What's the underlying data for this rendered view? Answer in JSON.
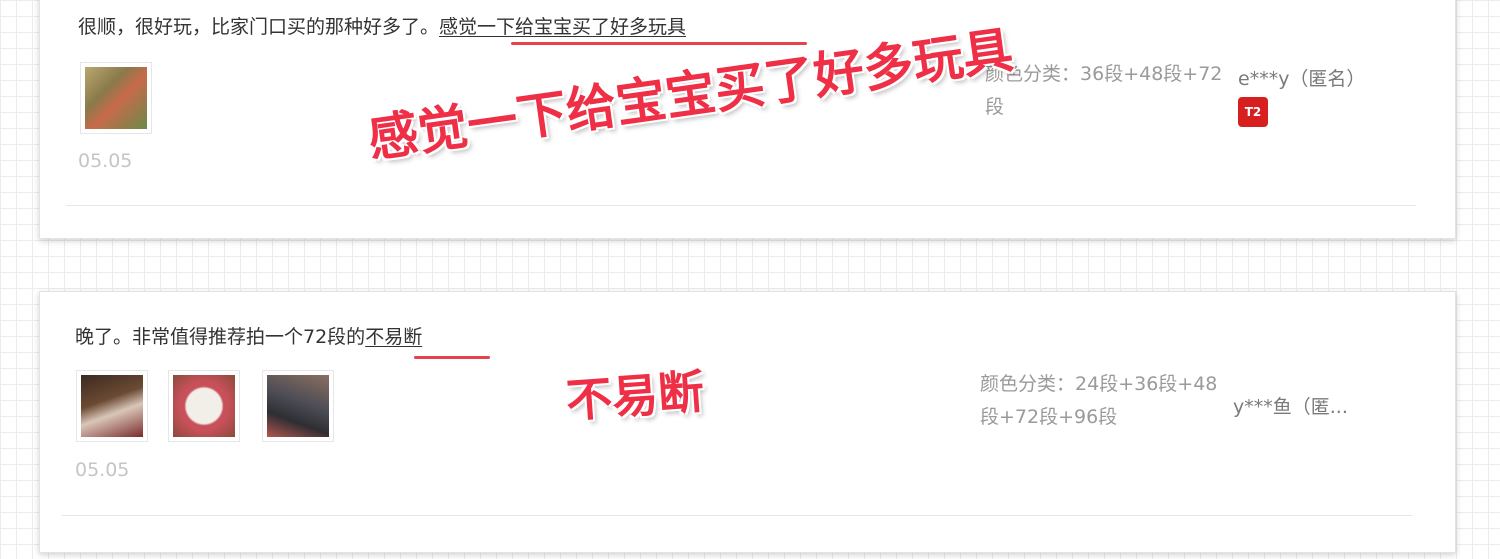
{
  "reviews": [
    {
      "text_plain": "很顺，很好玩，比家门口买的那种好多了。",
      "text_highlight": "感觉一下给宝宝买了好多玩具",
      "date": "05.05",
      "spec_label": "颜色分类：",
      "spec_value": "36段+48段+72段",
      "user": "e***y（匿名）",
      "user_badge": "T2",
      "annotation": "感觉一下给宝宝买了好多玩具",
      "photo_colors": [
        "#8a7a4a"
      ]
    },
    {
      "text_plain": "晚了。非常值得推荐拍一个72段的",
      "text_highlight": "不易断",
      "date": "05.05",
      "spec_label": "颜色分类：",
      "spec_value": "24段+36段+48段+72段+96段",
      "user": "y***鱼（匿...",
      "annotation": "不易断",
      "photo_colors": [
        "#6b4a33",
        "#9a5a45",
        "#4b4b55"
      ]
    }
  ],
  "colors": {
    "accent_red": "#ee2f46",
    "underline_red": "#e8414e"
  }
}
